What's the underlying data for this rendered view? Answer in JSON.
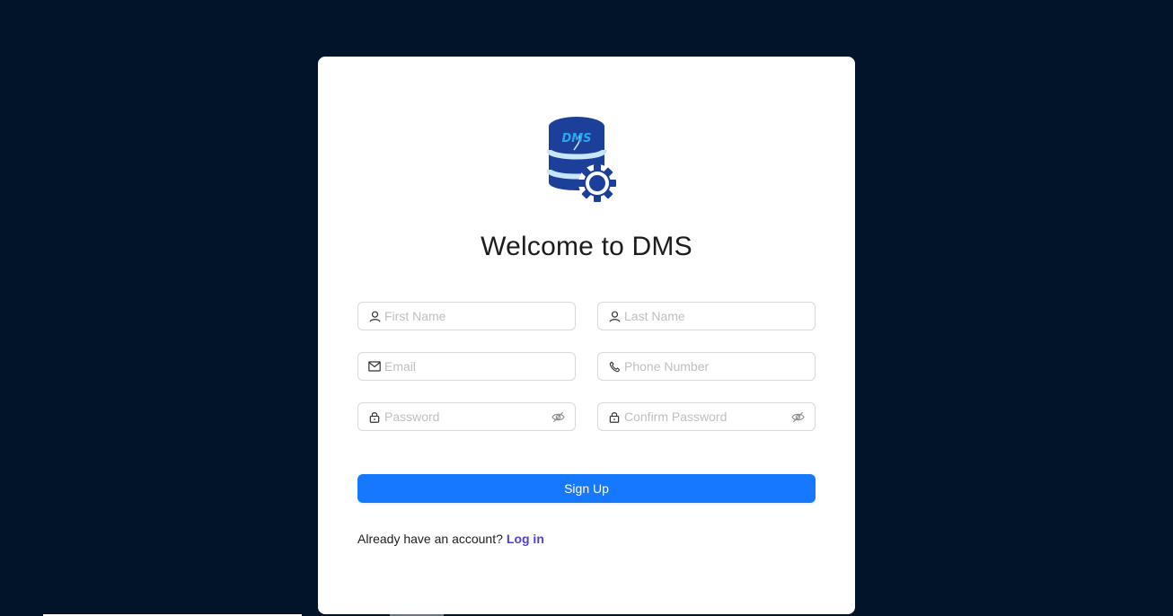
{
  "app": {
    "title": "Welcome to DMS",
    "logo_text": "DMS"
  },
  "form": {
    "first_name": {
      "placeholder": "First Name",
      "value": "",
      "icon": "user-icon"
    },
    "last_name": {
      "placeholder": "Last Name",
      "value": "",
      "icon": "user-icon"
    },
    "email": {
      "placeholder": "Email",
      "value": "",
      "icon": "mail-icon"
    },
    "phone": {
      "placeholder": "Phone Number",
      "value": "",
      "icon": "phone-icon"
    },
    "password": {
      "placeholder": "Password",
      "value": "",
      "icon": "lock-icon",
      "toggle_icon": "eye-invisible-icon"
    },
    "confirm_password": {
      "placeholder": "Confirm Password",
      "value": "",
      "icon": "lock-icon",
      "toggle_icon": "eye-invisible-icon"
    },
    "submit_label": "Sign Up"
  },
  "footer": {
    "prompt": "Already have an account?",
    "link_label": "Log in"
  },
  "colors": {
    "background": "#011429",
    "card": "#ffffff",
    "primary": "#1677ff",
    "link": "#4e3fd6",
    "logo_blue": "#1c3f99",
    "logo_accent": "#2aa7f0"
  }
}
